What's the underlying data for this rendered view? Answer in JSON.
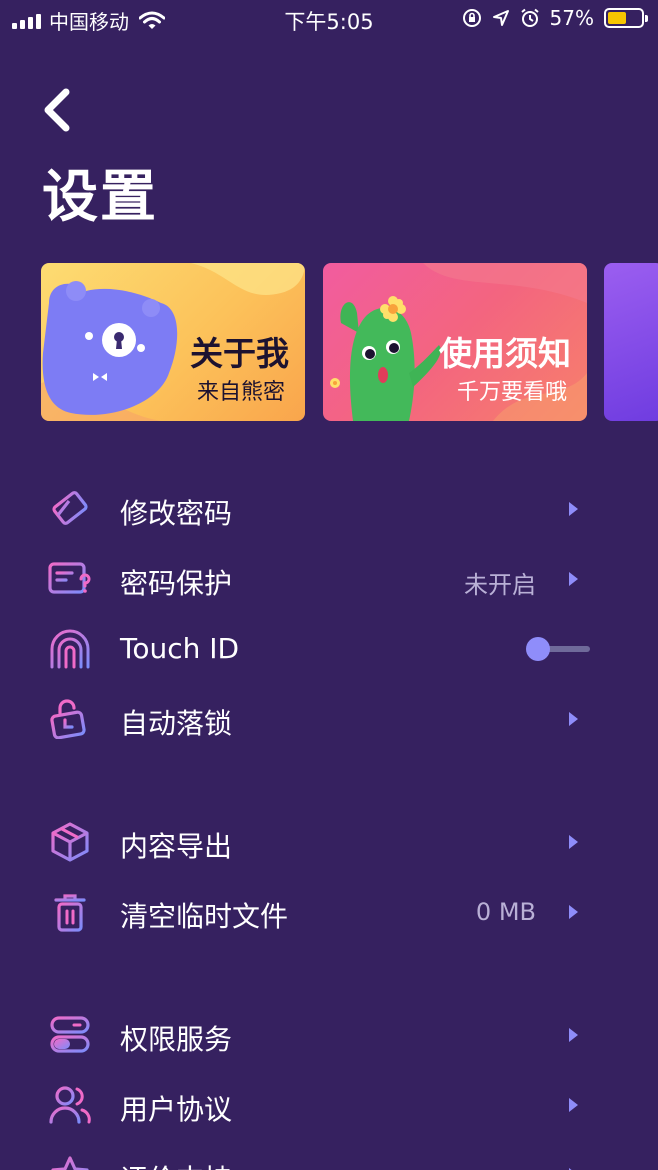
{
  "status_bar": {
    "carrier": "中国移动",
    "time": "下午5:05",
    "battery_percent": "57%",
    "battery_level": 0.57,
    "icons": [
      "signal-icon",
      "wifi-icon",
      "orientation-lock-icon",
      "location-icon",
      "alarm-icon",
      "battery-icon"
    ]
  },
  "header": {
    "back_icon": "chevron-left-icon",
    "title": "设置"
  },
  "cards": [
    {
      "title": "关于我",
      "subtitle": "来自熊密"
    },
    {
      "title": "使用须知",
      "subtitle": "千万要看哦"
    }
  ],
  "menu": {
    "change_password": {
      "label": "修改密码",
      "icon": "eraser-icon"
    },
    "password_protection": {
      "label": "密码保护",
      "value": "未开启",
      "icon": "card-question-icon"
    },
    "touch_id": {
      "label": "Touch ID",
      "enabled": false,
      "icon": "fingerprint-icon"
    },
    "auto_lock": {
      "label": "自动落锁",
      "icon": "lock-clock-icon"
    },
    "export_content": {
      "label": "内容导出",
      "icon": "box-icon"
    },
    "clear_temp": {
      "label": "清空临时文件",
      "value": "0 MB",
      "icon": "trash-icon"
    },
    "permissions": {
      "label": "权限服务",
      "icon": "toggles-icon"
    },
    "user_agreement": {
      "label": "用户协议",
      "icon": "users-icon"
    },
    "rate_support": {
      "label": "评价支持",
      "icon": "star-icon"
    }
  },
  "colors": {
    "background": "#362160",
    "accent": "#8f8dfa",
    "icon_gradient_start": "#f06bc8",
    "icon_gradient_end": "#7c8cfb",
    "secondary_text": "#b9b0d6"
  }
}
